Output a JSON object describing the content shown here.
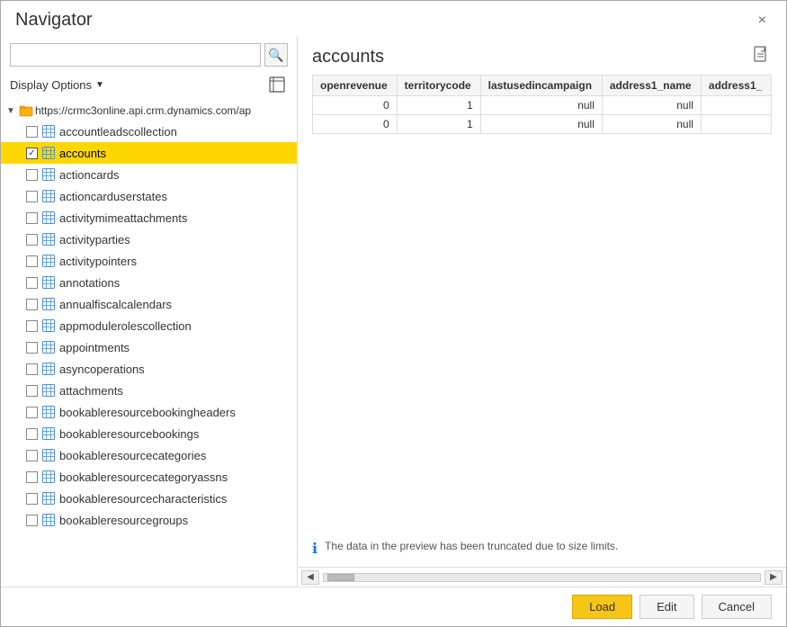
{
  "dialog": {
    "title": "Navigator",
    "close_label": "×"
  },
  "left_panel": {
    "search": {
      "placeholder": "",
      "search_icon": "🔍"
    },
    "display_options": {
      "label": "Display Options",
      "arrow": "▼"
    },
    "nav_icon": "📋",
    "root": {
      "label": "https://crmc3online.api.crm.dynamics.com/ap",
      "expanded": true
    },
    "items": [
      {
        "id": "accountleadscollection",
        "label": "accountleadscollection",
        "checked": false,
        "selected": false
      },
      {
        "id": "accounts",
        "label": "accounts",
        "checked": true,
        "selected": true
      },
      {
        "id": "actioncards",
        "label": "actioncards",
        "checked": false,
        "selected": false
      },
      {
        "id": "actioncarduserstates",
        "label": "actioncarduserstates",
        "checked": false,
        "selected": false
      },
      {
        "id": "activitymimeattachments",
        "label": "activitymimeattachments",
        "checked": false,
        "selected": false
      },
      {
        "id": "activityparties",
        "label": "activityparties",
        "checked": false,
        "selected": false
      },
      {
        "id": "activitypointers",
        "label": "activitypointers",
        "checked": false,
        "selected": false
      },
      {
        "id": "annotations",
        "label": "annotations",
        "checked": false,
        "selected": false
      },
      {
        "id": "annualfiscalcalendars",
        "label": "annualfiscalcalendars",
        "checked": false,
        "selected": false
      },
      {
        "id": "appmodulerolescollection",
        "label": "appmodulerolescollection",
        "checked": false,
        "selected": false
      },
      {
        "id": "appointments",
        "label": "appointments",
        "checked": false,
        "selected": false
      },
      {
        "id": "asyncoperations",
        "label": "asyncoperations",
        "checked": false,
        "selected": false
      },
      {
        "id": "attachments",
        "label": "attachments",
        "checked": false,
        "selected": false
      },
      {
        "id": "bookableresourcebookingheaders",
        "label": "bookableresourcebookingheaders",
        "checked": false,
        "selected": false
      },
      {
        "id": "bookableresourcebookings",
        "label": "bookableresourcebookings",
        "checked": false,
        "selected": false
      },
      {
        "id": "bookableresourcecategories",
        "label": "bookableresourcecategories",
        "checked": false,
        "selected": false
      },
      {
        "id": "bookableresourcecategoryassns",
        "label": "bookableresourcecategoryassns",
        "checked": false,
        "selected": false
      },
      {
        "id": "bookableresourcecharacteristics",
        "label": "bookableresourcecharacteristics",
        "checked": false,
        "selected": false
      },
      {
        "id": "bookableresourcegroups",
        "label": "bookableresourcegroups",
        "checked": false,
        "selected": false
      }
    ]
  },
  "right_panel": {
    "title": "accounts",
    "preview_icon": "📄",
    "table": {
      "columns": [
        "openrevenue",
        "territorycode",
        "lastusedincampaign",
        "address1_name",
        "address1_"
      ],
      "rows": [
        [
          "0",
          "1",
          "null",
          "null",
          ""
        ],
        [
          "0",
          "1",
          "null",
          "null",
          ""
        ]
      ]
    },
    "info_message": "The data in the preview has been truncated due to size limits."
  },
  "footer": {
    "load_label": "Load",
    "edit_label": "Edit",
    "cancel_label": "Cancel"
  }
}
